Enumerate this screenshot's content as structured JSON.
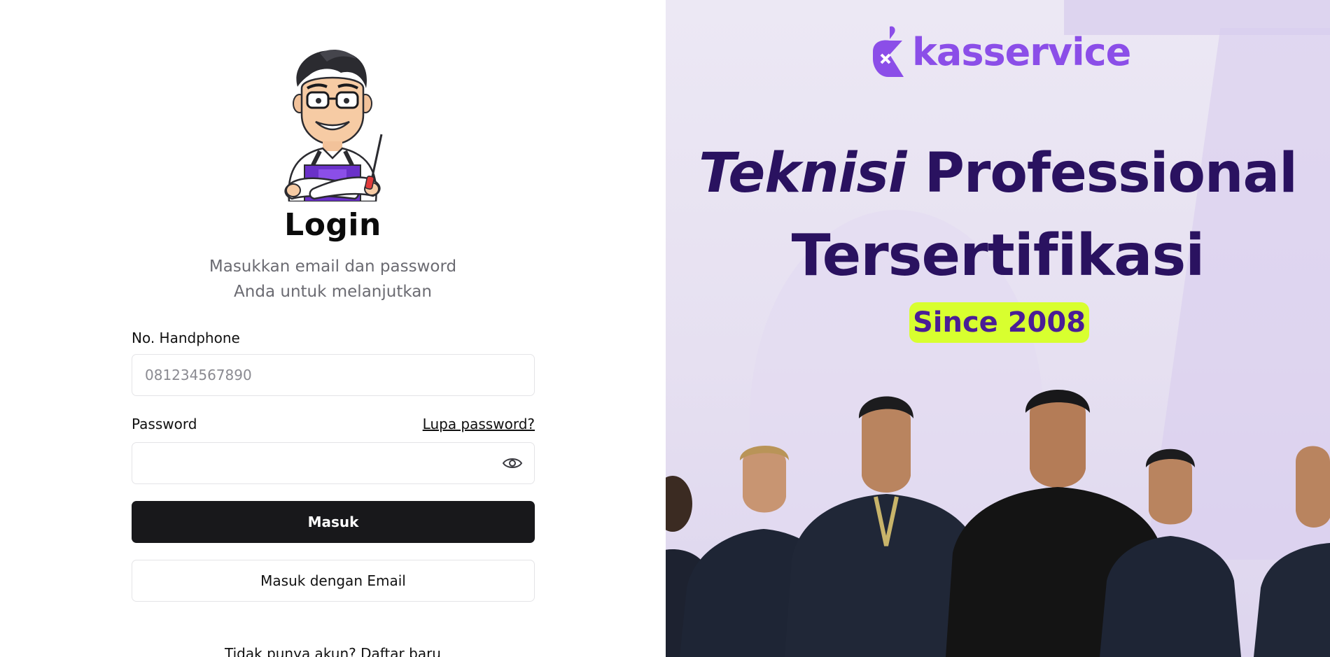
{
  "login": {
    "title": "Login",
    "subtitle_line1": "Masukkan email dan password",
    "subtitle_line2": "Anda untuk melanjutkan",
    "phone_label": "No. Handphone",
    "phone_placeholder": "081234567890",
    "phone_value": "",
    "password_label": "Password",
    "password_value": "",
    "forgot_link": "Lupa password?",
    "submit_button": "Masuk",
    "email_button": "Masuk dengan Email",
    "signup_prompt": "Tidak punya akun?",
    "signup_link": "Daftar baru"
  },
  "promo": {
    "brand_name": "kasservice",
    "headline_italic": "Teknisi",
    "headline_rest": "Professional",
    "headline_line2": "Tersertifikasi",
    "badge": "Since 2008"
  },
  "icons": {
    "mascot": "mascot-technician-icon",
    "password_toggle": "eye-icon",
    "brand_logo": "kasservice-logo-icon"
  },
  "colors": {
    "primary_button": "#18181b",
    "brand_purple": "#8b4ee8",
    "headline": "#2a1260",
    "badge_bg": "#d8ff2f",
    "promo_bg": "#ece8f4"
  }
}
